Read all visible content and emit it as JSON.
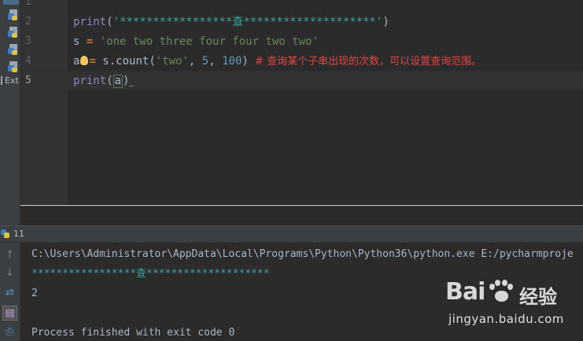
{
  "gutter": {
    "line_numbers": [
      "1",
      "2",
      "3",
      "4",
      "5"
    ],
    "current_line": "5"
  },
  "project_panel": {
    "ext_label": "Ext"
  },
  "code": {
    "line2": {
      "fn": "print",
      "open": "(",
      "str": "'*****************查********************'",
      "close": ")"
    },
    "line3": {
      "var": "s",
      "assign": " = ",
      "str": "'one two three four four two two'"
    },
    "line4": {
      "var": "a",
      "assign": "= ",
      "obj": "s.count",
      "open": "(",
      "str": "'two'",
      "sep1": ", ",
      "n1": "5",
      "sep2": ", ",
      "n2": "100",
      "close": ")",
      "comment": "  # 查询某个子串出现的次数，可以设置查询范围。"
    },
    "line5": {
      "fn": "print",
      "open": "(",
      "arg": "a",
      "close": ")"
    }
  },
  "run_panel": {
    "title": "11",
    "icon": "python-run-icon"
  },
  "console": {
    "command": "C:\\Users\\Administrator\\AppData\\Local\\Programs\\Python\\Python36\\python.exe E:/pycharmproje",
    "stars_output": "*****************查********************",
    "value_output": "2",
    "process_text": "Process finished with exit code 0"
  },
  "toolbar_icons": [
    "up-arrow-icon",
    "down-arrow-icon",
    "soft-wrap-icon",
    "scroll-to-end-icon",
    "print-icon"
  ],
  "watermark": {
    "brand": "Bai",
    "brand2": "经验",
    "domain": "jingyan.baidu.com"
  },
  "colors": {
    "editor_bg": "#2b2b2b",
    "gutter_bg": "#313335",
    "string_green": "#6a8759",
    "teal_output": "#3ba69a",
    "comment_red": "#e04545",
    "number_blue": "#6897bb",
    "builtin_purple": "#8888c6"
  }
}
